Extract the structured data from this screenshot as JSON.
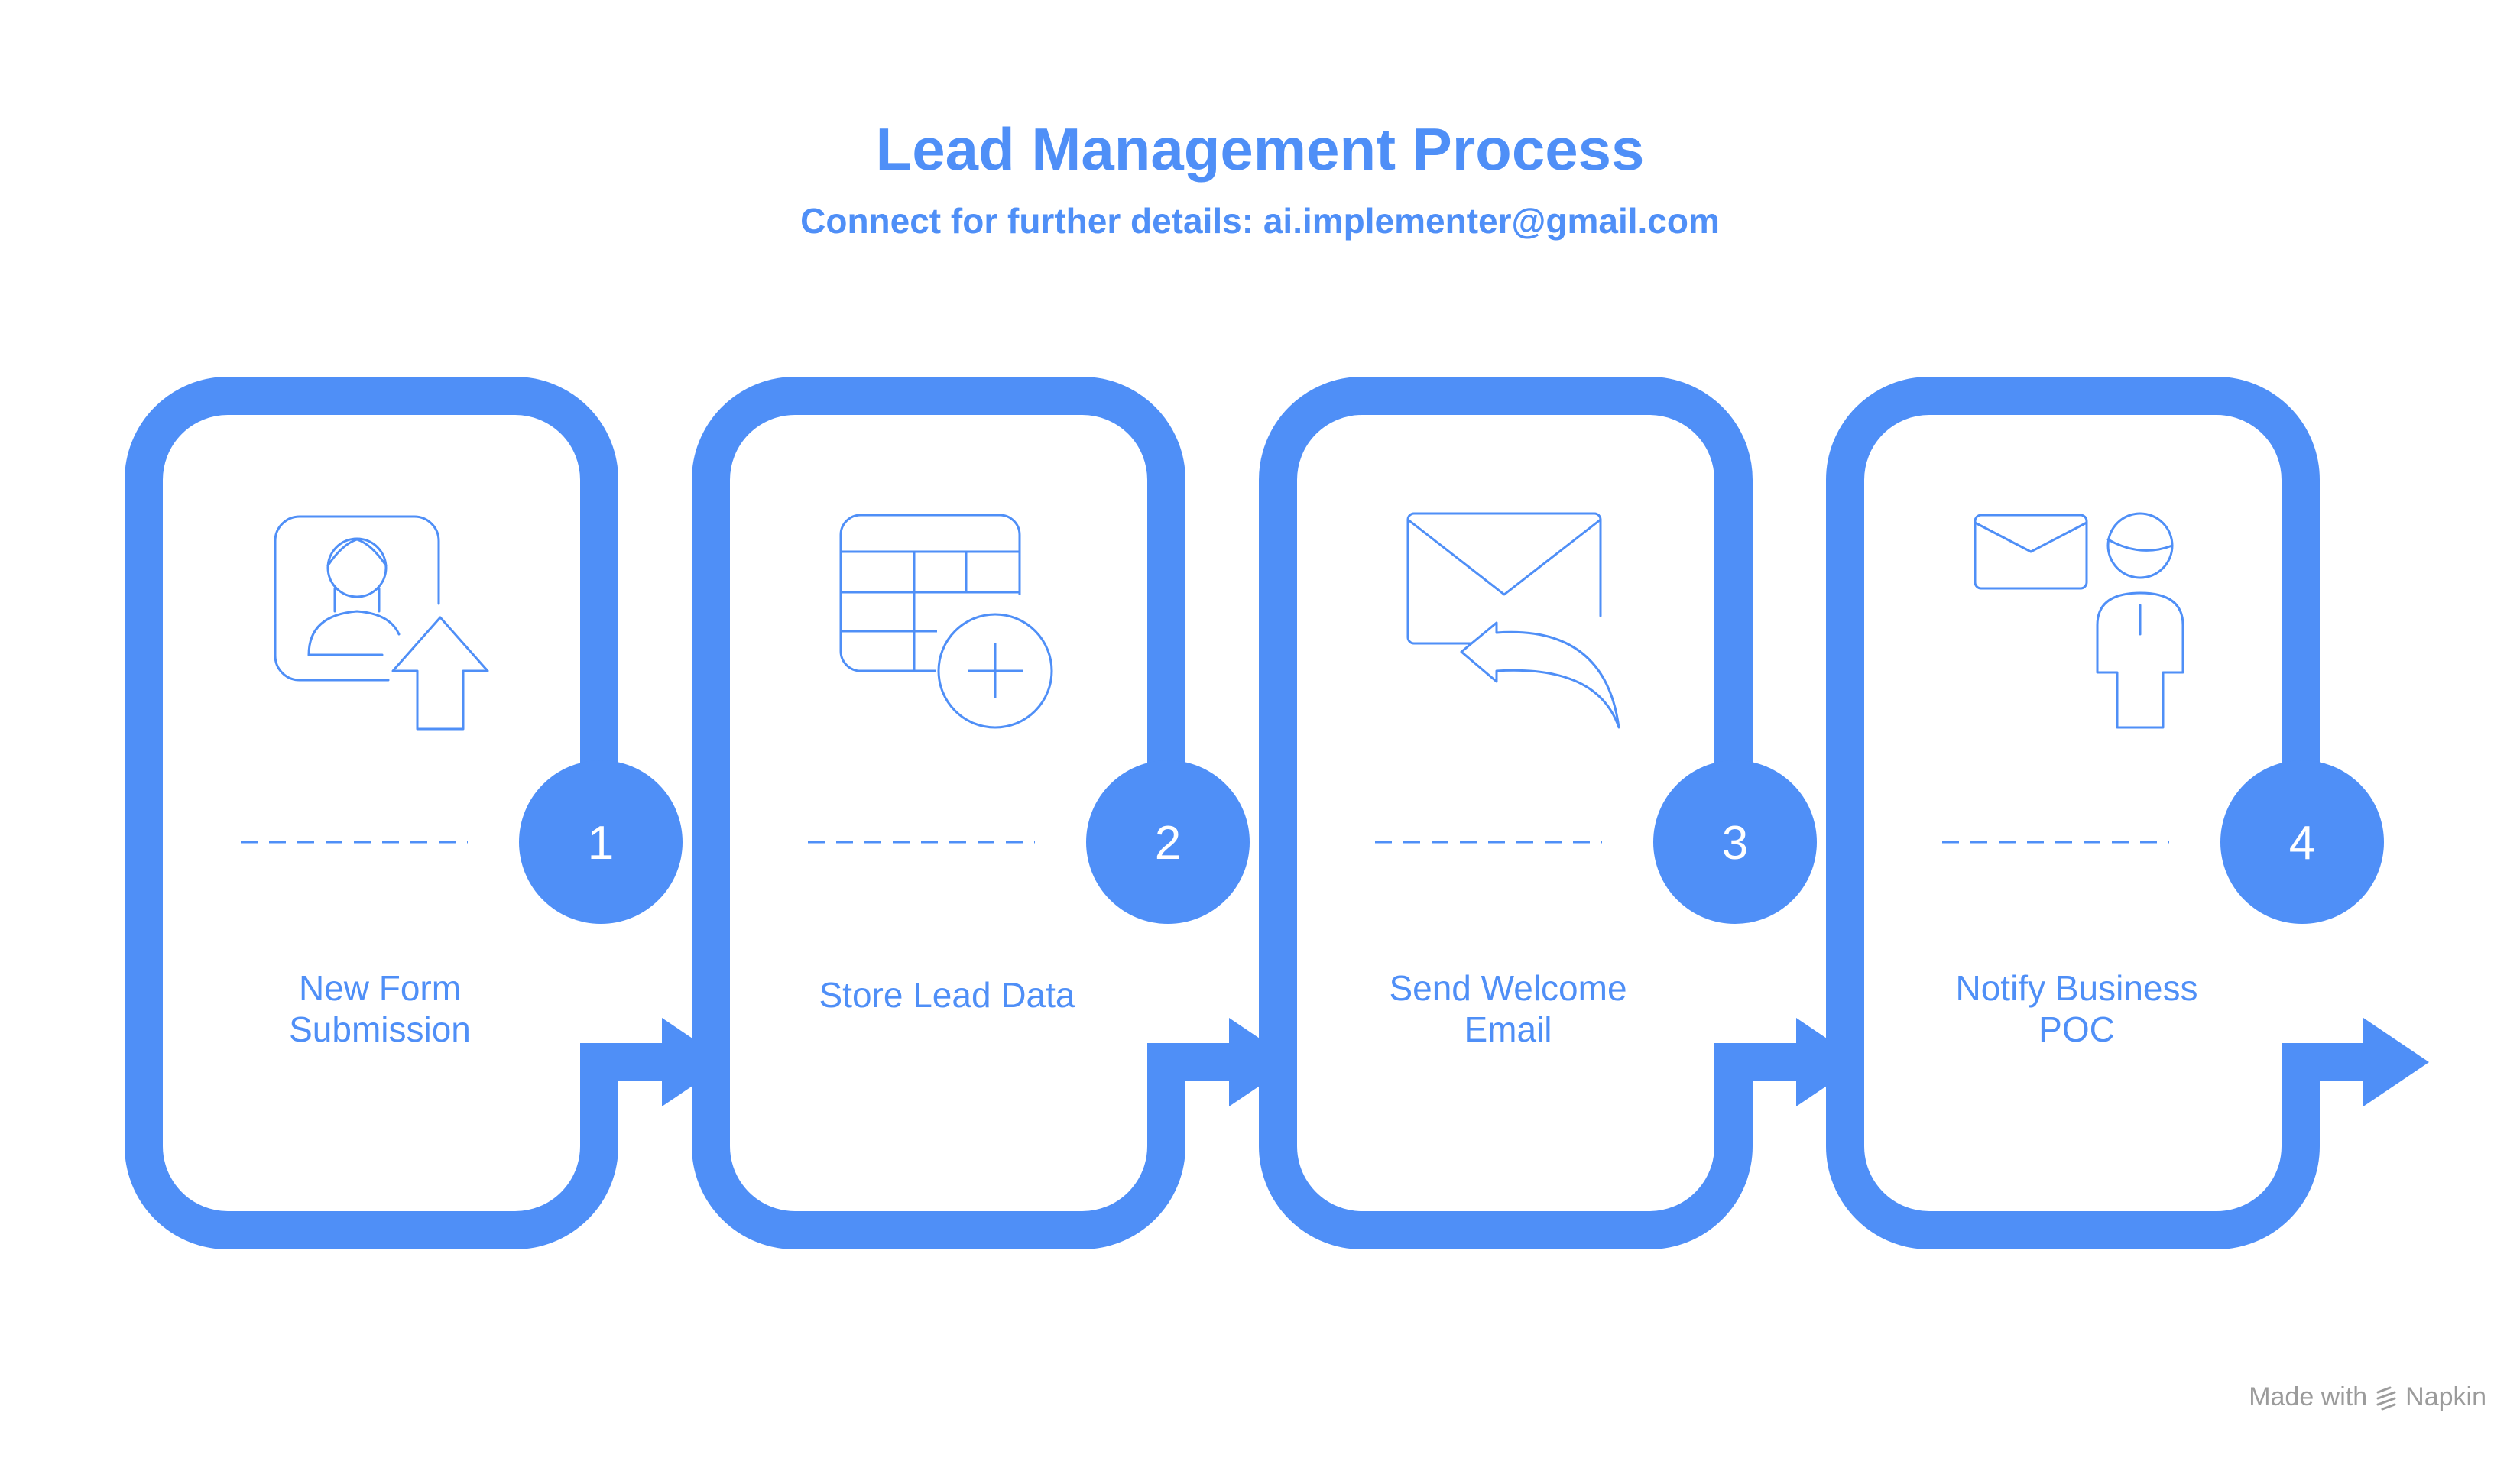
{
  "header": {
    "title": "Lead Management Process",
    "subtitle": "Connect for further details: ai.implementer@gmail.com"
  },
  "steps": [
    {
      "number": "1",
      "label_line1": "New Form",
      "label_line2": "Submission",
      "icon": "user-upload-icon"
    },
    {
      "number": "2",
      "label_line1": "Store Lead Data",
      "label_line2": "",
      "icon": "table-add-icon"
    },
    {
      "number": "3",
      "label_line1": "Send Welcome",
      "label_line2": "Email",
      "icon": "email-reply-icon"
    },
    {
      "number": "4",
      "label_line1": "Notify Business",
      "label_line2": "POC",
      "icon": "email-person-icon"
    }
  ],
  "footer": {
    "made_with": "Made with",
    "brand": "Napkin",
    "brand_icon": "napkin-logo-icon"
  },
  "colors": {
    "accent": "#4f8ff7",
    "watermark": "#9b9b9b"
  }
}
